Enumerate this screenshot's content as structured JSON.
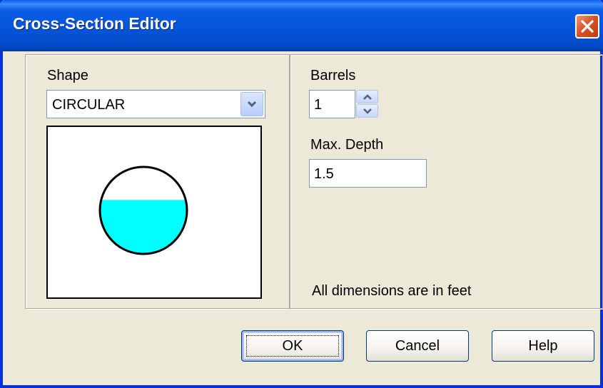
{
  "window": {
    "title": "Cross-Section Editor"
  },
  "shape": {
    "label": "Shape",
    "selected": "CIRCULAR",
    "fill_fraction": 0.62,
    "fill_color": "#00ffff"
  },
  "barrels": {
    "label": "Barrels",
    "value": "1"
  },
  "max_depth": {
    "label": "Max. Depth",
    "value": "1.5"
  },
  "note": "All dimensions are in feet",
  "buttons": {
    "ok": "OK",
    "cancel": "Cancel",
    "help": "Help"
  },
  "colors": {
    "titlebar": "#0454d9",
    "close": "#d9542a",
    "dialog_bg": "#ece9d8"
  }
}
